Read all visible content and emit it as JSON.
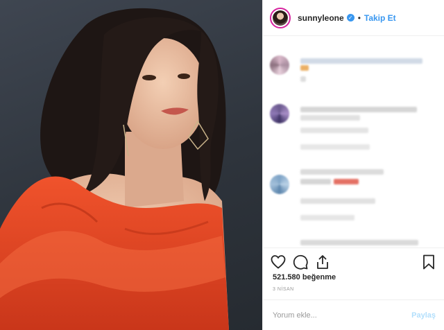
{
  "post": {
    "username": "sunnyleone",
    "verified_icon": "verified-badge-icon",
    "follow_label": "Takip Et",
    "separator": "•",
    "likes": "521.580 beğenme",
    "date": "3 NİSAN",
    "comment_placeholder": "Yorum ekle...",
    "share_label": "Paylaş"
  },
  "colors": {
    "accent": "#3897f0",
    "dress": "#e8421f",
    "backdrop": "#363c45"
  },
  "icons": [
    "heart-icon",
    "comment-icon",
    "share-icon",
    "bookmark-icon"
  ]
}
